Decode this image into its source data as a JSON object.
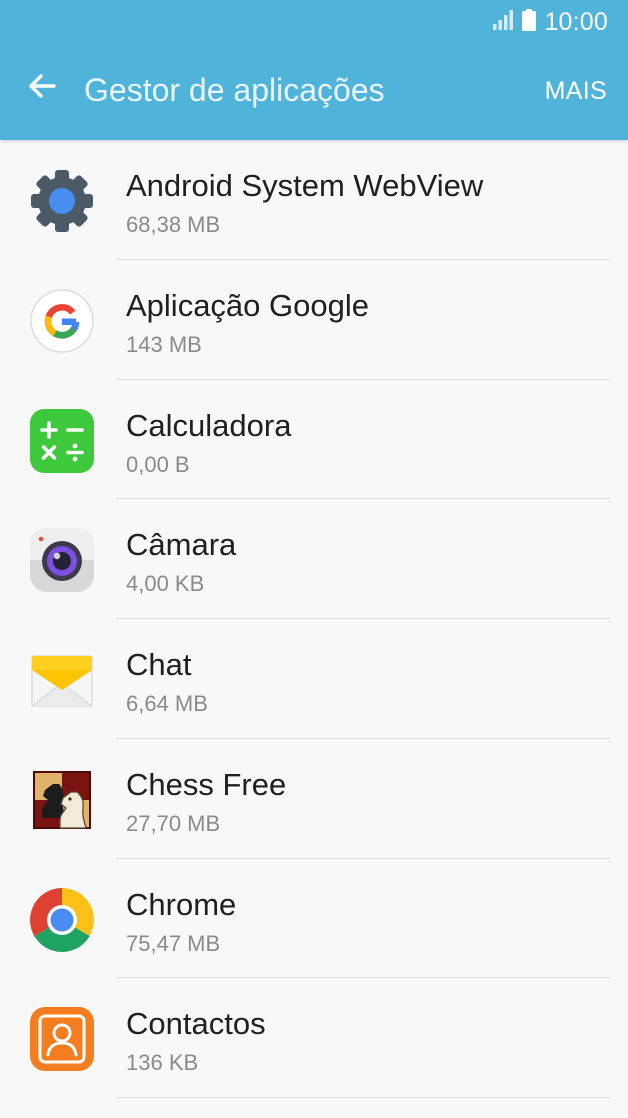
{
  "status_bar": {
    "time": "10:00",
    "signal_icon": "signal-bars-icon",
    "battery_icon": "battery-icon"
  },
  "header": {
    "title": "Gestor de aplicações",
    "back_icon": "arrow-back-icon",
    "more_label": "MAIS"
  },
  "colors": {
    "header_bg": "#4fb3da",
    "list_bg": "#f8f8f8",
    "primary_text": "#202020",
    "secondary_text": "#8a8a8a",
    "divider": "#dedede"
  },
  "apps": [
    {
      "name": "Android System WebView",
      "size": "68,38 MB",
      "icon": "android-webview-gear-icon"
    },
    {
      "name": "Aplicação Google",
      "size": "143 MB",
      "icon": "google-g-icon"
    },
    {
      "name": "Calculadora",
      "size": "0,00 B",
      "icon": "calculator-icon"
    },
    {
      "name": "Câmara",
      "size": "4,00 KB",
      "icon": "camera-icon"
    },
    {
      "name": "Chat",
      "size": "6,64 MB",
      "icon": "envelope-icon"
    },
    {
      "name": "Chess Free",
      "size": "27,70 MB",
      "icon": "chess-knight-icon"
    },
    {
      "name": "Chrome",
      "size": "75,47 MB",
      "icon": "chrome-icon"
    },
    {
      "name": "Contactos",
      "size": "136 KB",
      "icon": "contacts-person-icon"
    }
  ]
}
